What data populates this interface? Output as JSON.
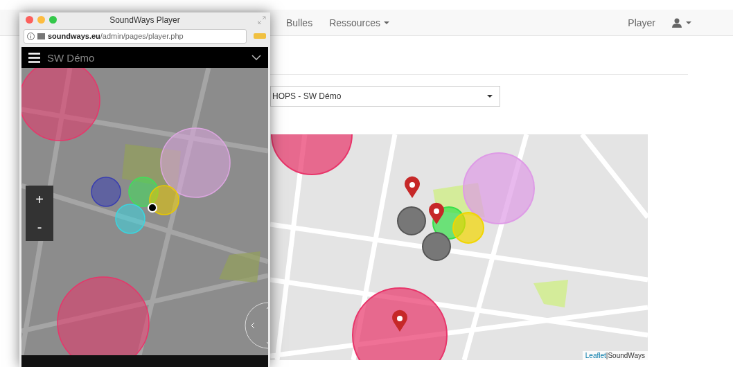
{
  "navbar": {
    "items": [
      {
        "label": "Bulles",
        "dropdown": false
      },
      {
        "label": "Ressources",
        "dropdown": true
      }
    ],
    "right_link": "Player"
  },
  "sound_select": {
    "value": "HOPS - SW Démo"
  },
  "map": {
    "zones": [
      {
        "color": "#e8356a"
      },
      {
        "color": "#de9be6"
      },
      {
        "color": "#37e04a"
      },
      {
        "color": "#f2d600"
      },
      {
        "color": "#e8356a"
      }
    ],
    "attribution_link": "Leaflet",
    "attribution_separator": "|",
    "attribution_text": "SoundWays"
  },
  "player_window": {
    "title": "SoundWays Player",
    "url_host": "soundways.eu",
    "url_path": "/admin/pages/player.php",
    "header_title": "SW Démo",
    "zoom_in": "+",
    "zoom_out": "-",
    "zones": [
      {
        "color": "#e8356a"
      },
      {
        "color": "#dca6e0"
      },
      {
        "color": "#3a3fb0"
      },
      {
        "color": "#3fe05a"
      },
      {
        "color": "#e8c800"
      },
      {
        "color": "#3ad6e0"
      },
      {
        "color": "#e8356a"
      }
    ]
  }
}
